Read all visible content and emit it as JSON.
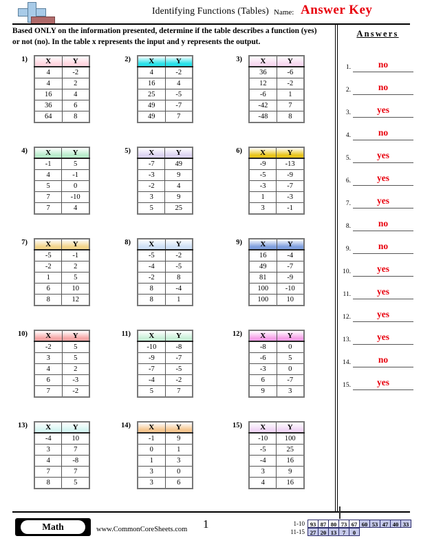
{
  "header": {
    "title": "Identifying Functions (Tables)",
    "name_label": "Name:",
    "answer_key": "Answer Key",
    "logo_icon": "math-plus-logo-icon",
    "accent_color": "#e8000d"
  },
  "instructions": "Based ONLY on the information presented, determine if the table describes a function (yes) or not (no). In the table x represents the input and y represents the output.",
  "answers_panel": {
    "title": "Answers",
    "items": [
      {
        "number": "1.",
        "value": "no"
      },
      {
        "number": "2.",
        "value": "no"
      },
      {
        "number": "3.",
        "value": "yes"
      },
      {
        "number": "4.",
        "value": "no"
      },
      {
        "number": "5.",
        "value": "yes"
      },
      {
        "number": "6.",
        "value": "yes"
      },
      {
        "number": "7.",
        "value": "yes"
      },
      {
        "number": "8.",
        "value": "no"
      },
      {
        "number": "9.",
        "value": "no"
      },
      {
        "number": "10.",
        "value": "yes"
      },
      {
        "number": "11.",
        "value": "yes"
      },
      {
        "number": "12.",
        "value": "yes"
      },
      {
        "number": "13.",
        "value": "yes"
      },
      {
        "number": "14.",
        "value": "no"
      },
      {
        "number": "15.",
        "value": "yes"
      }
    ]
  },
  "columns": [
    "X",
    "Y"
  ],
  "problems": [
    {
      "number": "1)",
      "header_color": "#ffd6e0",
      "rows": [
        [
          "4",
          "-2"
        ],
        [
          "4",
          "2"
        ],
        [
          "16",
          "4"
        ],
        [
          "36",
          "6"
        ],
        [
          "64",
          "8"
        ]
      ]
    },
    {
      "number": "2)",
      "header_color": "#28e0e8",
      "rows": [
        [
          "4",
          "-2"
        ],
        [
          "16",
          "4"
        ],
        [
          "25",
          "-5"
        ],
        [
          "49",
          "-7"
        ],
        [
          "49",
          "7"
        ]
      ]
    },
    {
      "number": "3)",
      "header_color": "#f7d9f0",
      "rows": [
        [
          "36",
          "-6"
        ],
        [
          "12",
          "-2"
        ],
        [
          "-6",
          "1"
        ],
        [
          "-42",
          "7"
        ],
        [
          "-48",
          "8"
        ]
      ]
    },
    {
      "number": "4)",
      "header_color": "#b9eccb",
      "rows": [
        [
          "-1",
          "5"
        ],
        [
          "4",
          "-1"
        ],
        [
          "5",
          "0"
        ],
        [
          "7",
          "-10"
        ],
        [
          "7",
          "4"
        ]
      ]
    },
    {
      "number": "5)",
      "header_color": "#ddd4f2",
      "rows": [
        [
          "-7",
          "49"
        ],
        [
          "-3",
          "9"
        ],
        [
          "-2",
          "4"
        ],
        [
          "3",
          "9"
        ],
        [
          "5",
          "25"
        ]
      ]
    },
    {
      "number": "6)",
      "header_color": "#e8c41a",
      "rows": [
        [
          "-9",
          "-13"
        ],
        [
          "-5",
          "-9"
        ],
        [
          "-3",
          "-7"
        ],
        [
          "1",
          "-3"
        ],
        [
          "3",
          "-1"
        ]
      ]
    },
    {
      "number": "7)",
      "header_color": "#f2d48a",
      "rows": [
        [
          "-5",
          "-1"
        ],
        [
          "-2",
          "2"
        ],
        [
          "1",
          "5"
        ],
        [
          "6",
          "10"
        ],
        [
          "8",
          "12"
        ]
      ]
    },
    {
      "number": "8)",
      "header_color": "#cfe0f5",
      "rows": [
        [
          "-5",
          "-2"
        ],
        [
          "-4",
          "-5"
        ],
        [
          "-2",
          "8"
        ],
        [
          "8",
          "-4"
        ],
        [
          "8",
          "1"
        ]
      ]
    },
    {
      "number": "9)",
      "header_color": "#7f9fdd",
      "rows": [
        [
          "16",
          "-4"
        ],
        [
          "49",
          "-7"
        ],
        [
          "81",
          "-9"
        ],
        [
          "100",
          "-10"
        ],
        [
          "100",
          "10"
        ]
      ]
    },
    {
      "number": "10)",
      "header_color": "#f7a6a6",
      "rows": [
        [
          "-2",
          "5"
        ],
        [
          "3",
          "5"
        ],
        [
          "4",
          "2"
        ],
        [
          "6",
          "-3"
        ],
        [
          "7",
          "-2"
        ]
      ]
    },
    {
      "number": "11)",
      "header_color": "#c9f0d8",
      "rows": [
        [
          "-10",
          "-8"
        ],
        [
          "-9",
          "-7"
        ],
        [
          "-7",
          "-5"
        ],
        [
          "-4",
          "-2"
        ],
        [
          "5",
          "7"
        ]
      ]
    },
    {
      "number": "12)",
      "header_color": "#f7a0e8",
      "rows": [
        [
          "-8",
          "0"
        ],
        [
          "-6",
          "5"
        ],
        [
          "-3",
          "0"
        ],
        [
          "6",
          "-7"
        ],
        [
          "9",
          "3"
        ]
      ]
    },
    {
      "number": "13)",
      "header_color": "#d6f5f2",
      "rows": [
        [
          "-4",
          "10"
        ],
        [
          "3",
          "7"
        ],
        [
          "4",
          "-8"
        ],
        [
          "7",
          "7"
        ],
        [
          "8",
          "5"
        ]
      ]
    },
    {
      "number": "14)",
      "header_color": "#f5c690",
      "rows": [
        [
          "-1",
          "9"
        ],
        [
          "0",
          "1"
        ],
        [
          "1",
          "3"
        ],
        [
          "3",
          "0"
        ],
        [
          "3",
          "6"
        ]
      ]
    },
    {
      "number": "15)",
      "header_color": "#f0d6f5",
      "rows": [
        [
          "-10",
          "100"
        ],
        [
          "-5",
          "25"
        ],
        [
          "-4",
          "16"
        ],
        [
          "3",
          "9"
        ],
        [
          "4",
          "16"
        ]
      ]
    }
  ],
  "footer": {
    "subject_badge": "Math",
    "website": "www.CommonCoreSheets.com",
    "page_number": "1",
    "score_rows": [
      {
        "label": "1-10",
        "cells": [
          {
            "value": "93",
            "shaded": false
          },
          {
            "value": "87",
            "shaded": false
          },
          {
            "value": "80",
            "shaded": false
          },
          {
            "value": "73",
            "shaded": false
          },
          {
            "value": "67",
            "shaded": false
          },
          {
            "value": "60",
            "shaded": true
          },
          {
            "value": "53",
            "shaded": true
          },
          {
            "value": "47",
            "shaded": true
          },
          {
            "value": "40",
            "shaded": true
          },
          {
            "value": "33",
            "shaded": true
          }
        ]
      },
      {
        "label": "11-15",
        "cells": [
          {
            "value": "27",
            "shaded": true
          },
          {
            "value": "20",
            "shaded": true
          },
          {
            "value": "13",
            "shaded": true
          },
          {
            "value": "7",
            "shaded": true
          },
          {
            "value": "0",
            "shaded": true
          }
        ]
      }
    ]
  }
}
